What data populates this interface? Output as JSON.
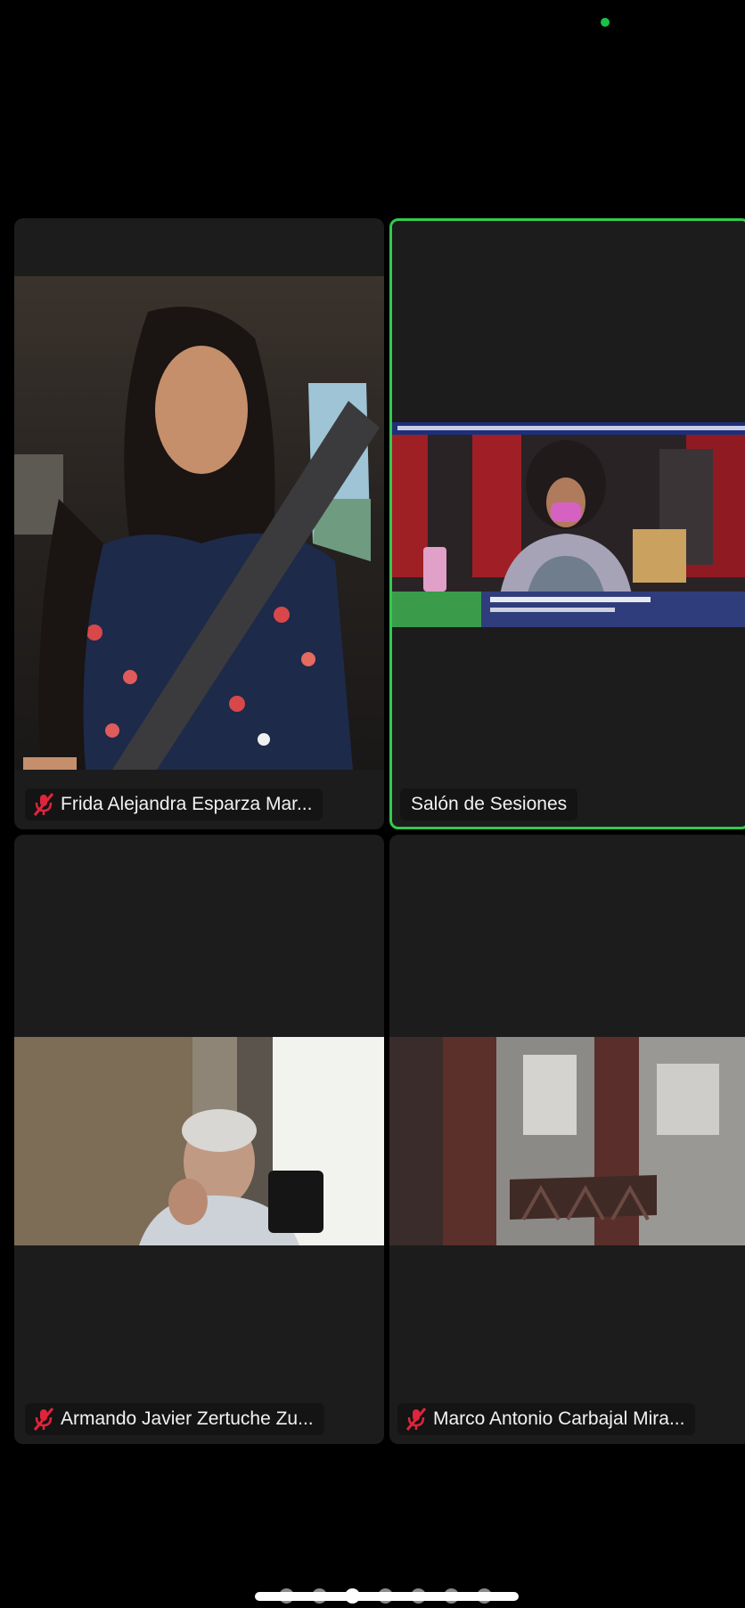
{
  "status": {
    "camera_indicator_color": "#19c24a"
  },
  "participants": [
    {
      "name": "Frida Alejandra Esparza Mar...",
      "muted": true,
      "mic_icon": "muted-mic-icon",
      "active_speaker": false
    },
    {
      "name": "Salón de Sesiones",
      "muted": false,
      "active_speaker": true,
      "active_border_color": "#34c94f"
    },
    {
      "name": "Armando Javier Zertuche Zu...",
      "muted": true,
      "mic_icon": "muted-mic-icon",
      "active_speaker": false
    },
    {
      "name": "Marco Antonio Carbajal Mira...",
      "muted": true,
      "mic_icon": "muted-mic-icon",
      "active_speaker": false
    }
  ],
  "pagination": {
    "total_pages": 7,
    "current_page": 3
  },
  "colors": {
    "background": "#000000",
    "tile_background": "#1c1c1c",
    "muted_icon": "#e0243b",
    "active_border": "#34c94f"
  }
}
